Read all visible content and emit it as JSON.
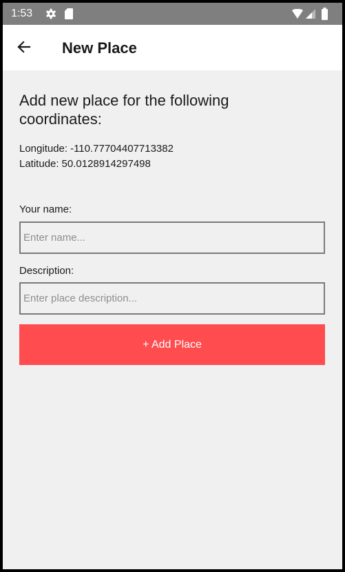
{
  "status_bar": {
    "time": "1:53",
    "icons": [
      "gear-icon",
      "sd-card-icon",
      "wifi-icon",
      "signal-icon",
      "battery-icon"
    ],
    "background": "#7f7f7f"
  },
  "app_bar": {
    "back_icon": "arrow-left-icon",
    "title": "New Place"
  },
  "main": {
    "heading": "Add new place for the following coordinates:",
    "longitude_label": "Longitude:",
    "longitude_value": "-110.77704407713382",
    "latitude_label": "Latitude:",
    "latitude_value": "50.0128914297498"
  },
  "form": {
    "name_label": "Your name:",
    "name_placeholder": "Enter name...",
    "description_label": "Description:",
    "description_placeholder": "Enter place description...",
    "submit_label": "+ Add Place"
  },
  "colors": {
    "accent": "#ff4c4f",
    "background": "#f0f0f0",
    "app_bar": "#ffffff"
  }
}
